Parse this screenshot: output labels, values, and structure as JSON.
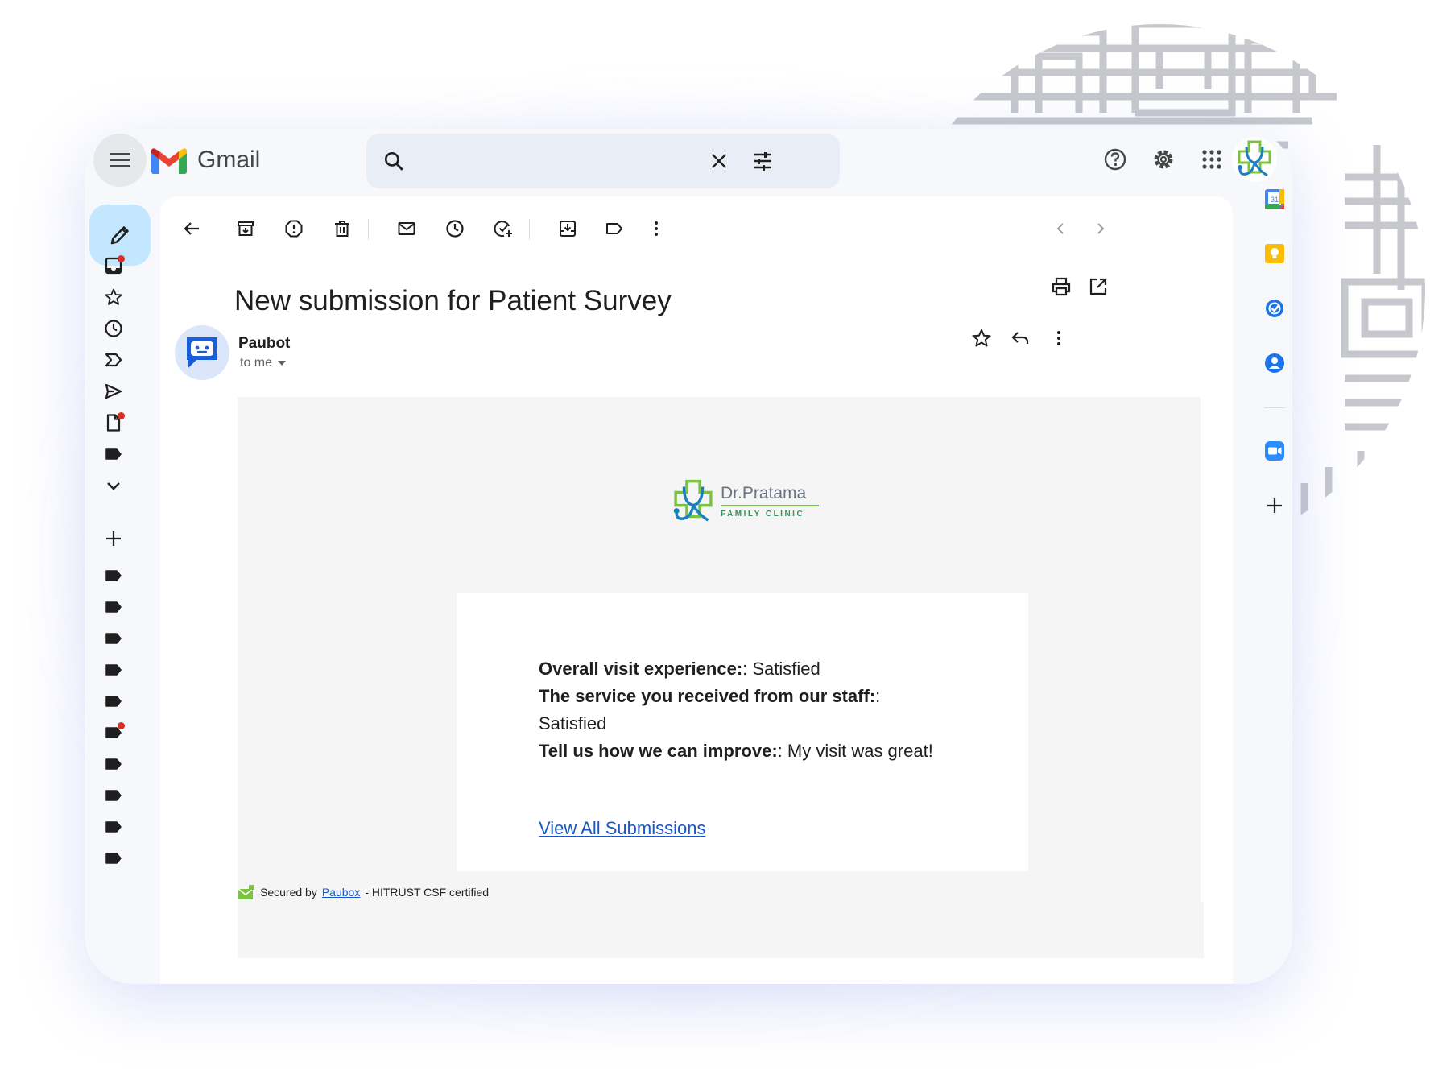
{
  "app": {
    "name": "Gmail"
  },
  "search": {
    "placeholder": ""
  },
  "email": {
    "subject": "New submission for Patient Survey",
    "sender": "Paubot",
    "recipient": "to me",
    "clinic": {
      "name": "Dr.Pratama",
      "tagline": "FAMILY CLINIC"
    },
    "fields": [
      {
        "label": "Overall visit experience:",
        "value": ": Satisfied"
      },
      {
        "label": "The service you received from our staff:",
        "value": ":"
      },
      {
        "label": "",
        "value": "Satisfied"
      },
      {
        "label": "Tell us how we can improve:",
        "value": ": My visit was great!"
      }
    ],
    "link_text": "View All Submissions",
    "footer": {
      "prefix": "Secured by ",
      "link": "Paubox",
      "suffix": " - HITRUST CSF certified"
    }
  },
  "icons": {
    "left_rail": [
      "inbox-icon",
      "star-icon",
      "clock-icon",
      "important-icon",
      "send-icon",
      "draft-icon",
      "label-icon",
      "chevron-down-icon",
      "plus-icon"
    ],
    "toolbar": [
      "back-arrow-icon",
      "archive-icon",
      "report-spam-icon",
      "delete-icon",
      "mark-unread-icon",
      "snooze-icon",
      "add-task-icon",
      "move-to-icon",
      "label-icon",
      "more-vert-icon"
    ],
    "right_rail": [
      "calendar-icon",
      "keep-icon",
      "tasks-icon",
      "contacts-icon",
      "zoom-icon",
      "plus-icon"
    ]
  },
  "colors": {
    "accent": "#0b57d0",
    "compose_bg": "#c2e7ff",
    "unread_dot": "#d93025",
    "link": "#1a56c4"
  }
}
